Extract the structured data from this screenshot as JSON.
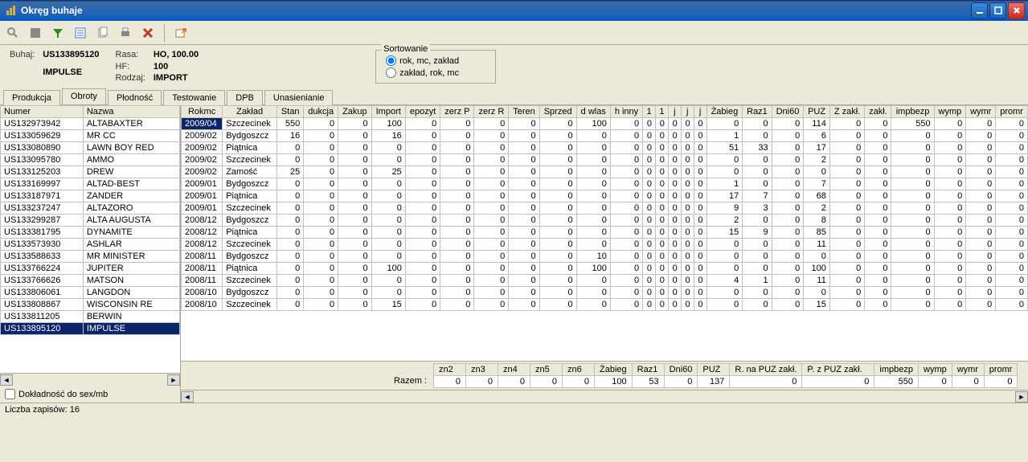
{
  "window": {
    "title": "Okręg buhaje"
  },
  "toolbar_icons": [
    "search",
    "disk",
    "filter",
    "form",
    "copy",
    "print",
    "delete",
    "",
    "new-window"
  ],
  "info": {
    "buhaj_label": "Buhaj:",
    "buhaj": "US133895120",
    "impulse": "IMPULSE",
    "rasa_label": "Rasa:",
    "rasa": "HO, 100.00",
    "hf_label": "HF:",
    "hf": "100",
    "rodzaj_label": "Rodzaj:",
    "rodzaj": "IMPORT"
  },
  "sort": {
    "legend": "Sortowanie",
    "opt1": "rok, mc, zakład",
    "opt2": "zakład, rok, mc"
  },
  "tabs": [
    "Produkcja",
    "Obroty",
    "Płodność",
    "Testowanie",
    "DPB",
    "Unasienianie"
  ],
  "active_tab": 1,
  "left": {
    "headers": [
      "Numer",
      "Nazwa"
    ],
    "rows": [
      [
        "US132973942",
        "ALTABAXTER"
      ],
      [
        "US133059629",
        "MR CC"
      ],
      [
        "US133080890",
        "LAWN BOY RED"
      ],
      [
        "US133095780",
        "AMMO"
      ],
      [
        "US133125203",
        "DREW"
      ],
      [
        "US133169997",
        "ALTAD-BEST"
      ],
      [
        "US133187971",
        "ZANDER"
      ],
      [
        "US133237247",
        "ALTAZORO"
      ],
      [
        "US133299287",
        "ALTA AUGUSTA"
      ],
      [
        "US133381795",
        "DYNAMITE"
      ],
      [
        "US133573930",
        "ASHLAR"
      ],
      [
        "US133588633",
        "MR MINISTER"
      ],
      [
        "US133766224",
        "JUPITER"
      ],
      [
        "US133766626",
        "MATSON"
      ],
      [
        "US133806061",
        "LANGDON"
      ],
      [
        "US133808867",
        "WISCONSIN RE"
      ],
      [
        "US133811205",
        "BERWIN"
      ],
      [
        "US133895120",
        "IMPULSE"
      ]
    ],
    "selected": 17
  },
  "right": {
    "headers": [
      "Rokmc",
      "Zakład",
      "Stan",
      "dukcja",
      "Zakup",
      "Import",
      "epozyt",
      "zerz P",
      "zerz R",
      "Teren",
      "Sprzed",
      "d wlas",
      "h inny",
      "1",
      "1",
      "j",
      "j",
      "j",
      "Żabieg",
      "Raz1",
      "Dni60",
      "PUZ",
      "Z zakł.",
      "zakł.",
      "impbezp",
      "wymp",
      "wymr",
      "promr"
    ],
    "rows": [
      [
        "2009/04",
        "Szczecinek",
        550,
        0,
        0,
        100,
        0,
        0,
        0,
        0,
        0,
        100,
        0,
        0,
        0,
        0,
        0,
        0,
        0,
        0,
        0,
        114,
        0,
        0,
        550,
        0,
        0,
        0
      ],
      [
        "2009/02",
        "Bydgoszcz",
        16,
        0,
        0,
        16,
        0,
        0,
        0,
        0,
        0,
        0,
        0,
        0,
        0,
        0,
        0,
        0,
        1,
        0,
        0,
        6,
        0,
        0,
        0,
        0,
        0,
        0
      ],
      [
        "2009/02",
        "Piątnica",
        0,
        0,
        0,
        0,
        0,
        0,
        0,
        0,
        0,
        0,
        0,
        0,
        0,
        0,
        0,
        0,
        51,
        33,
        0,
        17,
        0,
        0,
        0,
        0,
        0,
        0
      ],
      [
        "2009/02",
        "Szczecinek",
        0,
        0,
        0,
        0,
        0,
        0,
        0,
        0,
        0,
        0,
        0,
        0,
        0,
        0,
        0,
        0,
        0,
        0,
        0,
        2,
        0,
        0,
        0,
        0,
        0,
        0
      ],
      [
        "2009/02",
        "Zamość",
        25,
        0,
        0,
        25,
        0,
        0,
        0,
        0,
        0,
        0,
        0,
        0,
        0,
        0,
        0,
        0,
        0,
        0,
        0,
        0,
        0,
        0,
        0,
        0,
        0,
        0
      ],
      [
        "2009/01",
        "Bydgoszcz",
        0,
        0,
        0,
        0,
        0,
        0,
        0,
        0,
        0,
        0,
        0,
        0,
        0,
        0,
        0,
        0,
        1,
        0,
        0,
        7,
        0,
        0,
        0,
        0,
        0,
        0
      ],
      [
        "2009/01",
        "Piątnica",
        0,
        0,
        0,
        0,
        0,
        0,
        0,
        0,
        0,
        0,
        0,
        0,
        0,
        0,
        0,
        0,
        17,
        7,
        0,
        68,
        0,
        0,
        0,
        0,
        0,
        0
      ],
      [
        "2009/01",
        "Szczecinek",
        0,
        0,
        0,
        0,
        0,
        0,
        0,
        0,
        0,
        0,
        0,
        0,
        0,
        0,
        0,
        0,
        9,
        3,
        0,
        2,
        0,
        0,
        0,
        0,
        0,
        0
      ],
      [
        "2008/12",
        "Bydgoszcz",
        0,
        0,
        0,
        0,
        0,
        0,
        0,
        0,
        0,
        0,
        0,
        0,
        0,
        0,
        0,
        0,
        2,
        0,
        0,
        8,
        0,
        0,
        0,
        0,
        0,
        0
      ],
      [
        "2008/12",
        "Piątnica",
        0,
        0,
        0,
        0,
        0,
        0,
        0,
        0,
        0,
        0,
        0,
        0,
        0,
        0,
        0,
        0,
        15,
        9,
        0,
        85,
        0,
        0,
        0,
        0,
        0,
        0
      ],
      [
        "2008/12",
        "Szczecinek",
        0,
        0,
        0,
        0,
        0,
        0,
        0,
        0,
        0,
        0,
        0,
        0,
        0,
        0,
        0,
        0,
        0,
        0,
        0,
        11,
        0,
        0,
        0,
        0,
        0,
        0
      ],
      [
        "2008/11",
        "Bydgoszcz",
        0,
        0,
        0,
        0,
        0,
        0,
        0,
        0,
        0,
        10,
        0,
        0,
        0,
        0,
        0,
        0,
        0,
        0,
        0,
        0,
        0,
        0,
        0,
        0,
        0,
        0
      ],
      [
        "2008/11",
        "Piątnica",
        0,
        0,
        0,
        100,
        0,
        0,
        0,
        0,
        0,
        100,
        0,
        0,
        0,
        0,
        0,
        0,
        0,
        0,
        0,
        100,
        0,
        0,
        0,
        0,
        0,
        0
      ],
      [
        "2008/11",
        "Szczecinek",
        0,
        0,
        0,
        0,
        0,
        0,
        0,
        0,
        0,
        0,
        0,
        0,
        0,
        0,
        0,
        0,
        4,
        1,
        0,
        11,
        0,
        0,
        0,
        0,
        0,
        0
      ],
      [
        "2008/10",
        "Bydgoszcz",
        0,
        0,
        0,
        0,
        0,
        0,
        0,
        0,
        0,
        0,
        0,
        0,
        0,
        0,
        0,
        0,
        0,
        0,
        0,
        0,
        0,
        0,
        0,
        0,
        0,
        0
      ],
      [
        "2008/10",
        "Szczecinek",
        0,
        0,
        0,
        15,
        0,
        0,
        0,
        0,
        0,
        0,
        0,
        0,
        0,
        0,
        0,
        0,
        0,
        0,
        0,
        15,
        0,
        0,
        0,
        0,
        0,
        0
      ]
    ]
  },
  "summary": {
    "label": "Razem :",
    "headers": [
      "zn2",
      "zn3",
      "zn4",
      "zn5",
      "zn6",
      "Żabieg",
      "Raz1",
      "Dni60",
      "PUZ",
      "R. na PUZ zakł.",
      "P. z PUZ zakł.",
      "impbezp",
      "wymp",
      "wymr",
      "promr"
    ],
    "values": [
      0,
      0,
      0,
      0,
      0,
      100,
      53,
      0,
      137,
      0,
      0,
      550,
      0,
      0,
      0
    ]
  },
  "checkbox": {
    "label": "Dokładność do sex/mb"
  },
  "status": {
    "label": "Liczba zapisów:",
    "value": "16"
  }
}
